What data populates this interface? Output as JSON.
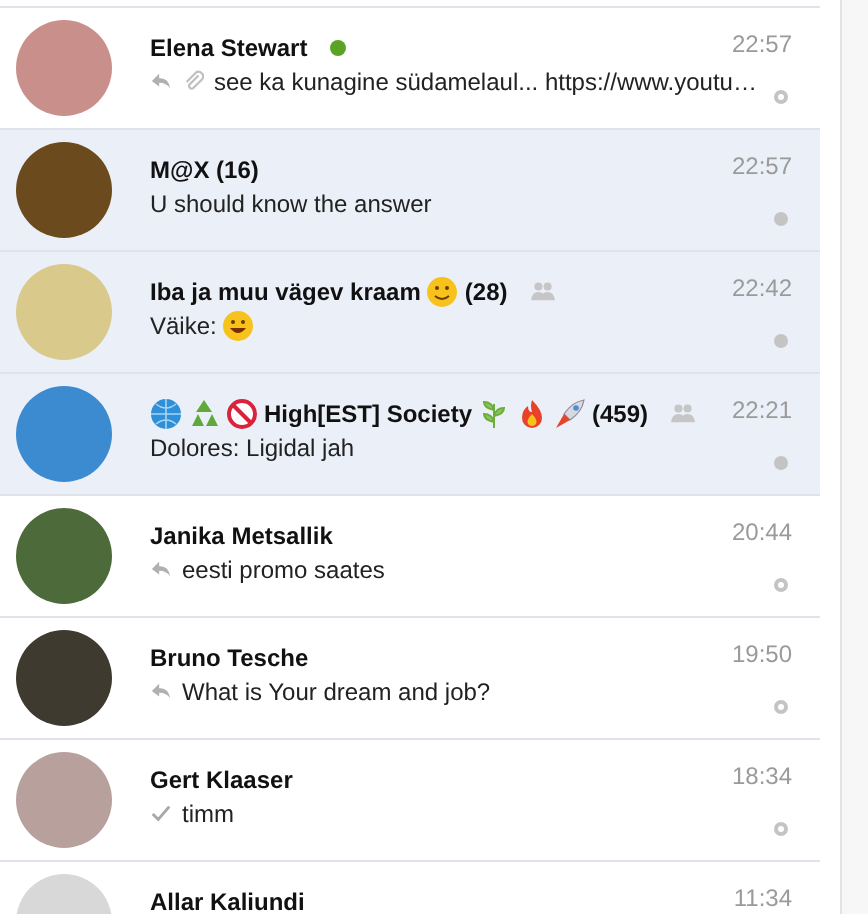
{
  "conversations": [
    {
      "title": [
        {
          "kind": "text",
          "text": "Elena Stewart"
        }
      ],
      "online": true,
      "group": false,
      "time": "22:57",
      "preview": [
        {
          "kind": "reply"
        },
        {
          "kind": "attachment"
        },
        {
          "kind": "text",
          "text": "see ka kunagine südamelaul... https://www.youtu…"
        }
      ],
      "unread": false,
      "read": true
    },
    {
      "title": [
        {
          "kind": "text",
          "text": "M@X (16)"
        }
      ],
      "online": false,
      "group": false,
      "time": "22:57",
      "preview": [
        {
          "kind": "text",
          "text": "U should know the answer"
        }
      ],
      "unread": true,
      "read": false
    },
    {
      "title": [
        {
          "kind": "text",
          "text": "Iba ja muu vägev kraam"
        },
        {
          "kind": "smile"
        },
        {
          "kind": "text",
          "text": "(28)"
        }
      ],
      "online": false,
      "group": true,
      "time": "22:42",
      "preview": [
        {
          "kind": "text",
          "text": "Väike:"
        },
        {
          "kind": "grin"
        }
      ],
      "unread": true,
      "read": false
    },
    {
      "title": [
        {
          "kind": "globe"
        },
        {
          "kind": "recycle"
        },
        {
          "kind": "no-under-18"
        },
        {
          "kind": "text",
          "text": "High[EST] Society"
        },
        {
          "kind": "herb"
        },
        {
          "kind": "fire"
        },
        {
          "kind": "rocket"
        },
        {
          "kind": "text",
          "text": "(459)"
        }
      ],
      "online": false,
      "group": true,
      "time": "22:21",
      "preview": [
        {
          "kind": "text",
          "text": "Dolores: Ligidal jah"
        }
      ],
      "unread": true,
      "read": false
    },
    {
      "title": [
        {
          "kind": "text",
          "text": "Janika Metsallik"
        }
      ],
      "online": false,
      "group": false,
      "time": "20:44",
      "preview": [
        {
          "kind": "reply"
        },
        {
          "kind": "text",
          "text": "eesti promo saates"
        }
      ],
      "unread": false,
      "read": true
    },
    {
      "title": [
        {
          "kind": "text",
          "text": "Bruno Tesche"
        }
      ],
      "online": false,
      "group": false,
      "time": "19:50",
      "preview": [
        {
          "kind": "reply"
        },
        {
          "kind": "text",
          "text": "What is Your dream and job?"
        }
      ],
      "unread": false,
      "read": true
    },
    {
      "title": [
        {
          "kind": "text",
          "text": "Gert Klaaser"
        }
      ],
      "online": false,
      "group": false,
      "time": "18:34",
      "preview": [
        {
          "kind": "check"
        },
        {
          "kind": "text",
          "text": "timm"
        }
      ],
      "unread": false,
      "read": true
    },
    {
      "title": [
        {
          "kind": "text",
          "text": "Allar Kaliundi"
        }
      ],
      "online": false,
      "group": false,
      "time": "11:34",
      "unread": false
    }
  ]
}
